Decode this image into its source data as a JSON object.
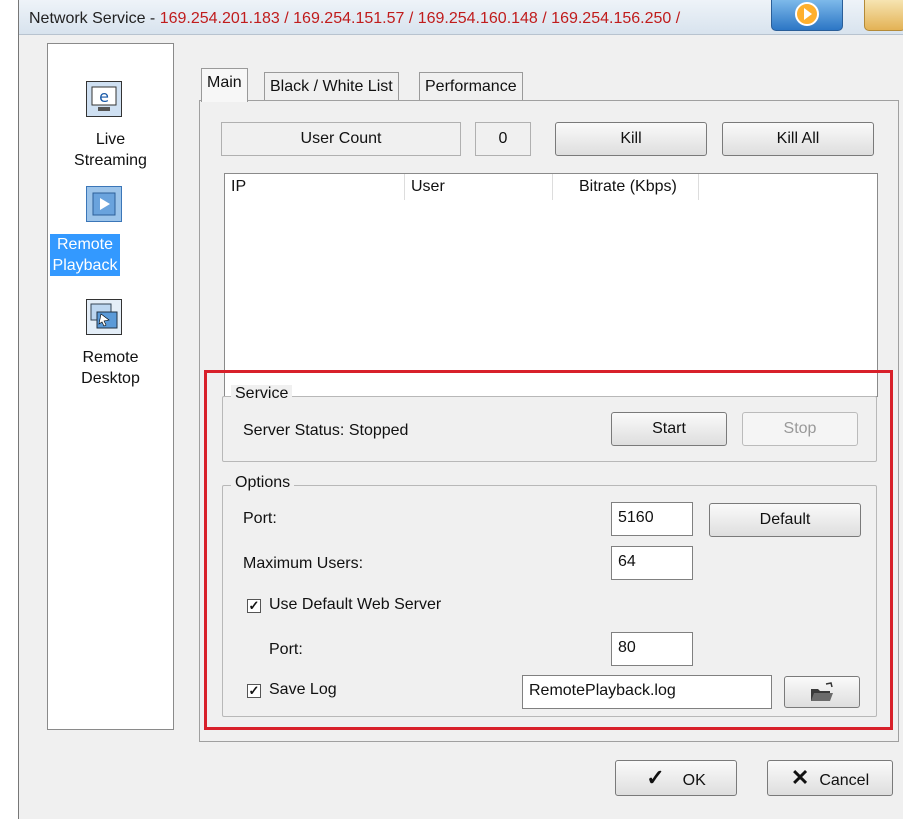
{
  "title": {
    "prefix": "Network Service - ",
    "ips": "169.254.201.183 / 169.254.151.57 / 169.254.160.148 / 169.254.156.250 /"
  },
  "sidebar": {
    "items": [
      {
        "label_line1": "Live",
        "label_line2": "Streaming",
        "icon": "live-streaming-icon",
        "selected": false
      },
      {
        "label_line1": "Remote",
        "label_line2": "Playback",
        "icon": "remote-playback-icon",
        "selected": true
      },
      {
        "label_line1": "Remote",
        "label_line2": "Desktop",
        "icon": "remote-desktop-icon",
        "selected": false
      }
    ]
  },
  "tabs": [
    "Main",
    "Black / White List",
    "Performance"
  ],
  "main": {
    "user_count_label": "User Count",
    "user_count_value": "0",
    "kill_label": "Kill",
    "kill_all_label": "Kill All",
    "columns": [
      "IP",
      "User",
      "Bitrate (Kbps)"
    ]
  },
  "service": {
    "legend": "Service",
    "status_text": "Server Status: Stopped",
    "start_label": "Start",
    "stop_label": "Stop"
  },
  "options": {
    "legend": "Options",
    "port_label": "Port:",
    "port_value": "5160",
    "default_label": "Default",
    "max_users_label": "Maximum Users:",
    "max_users_value": "64",
    "use_default_web_server_label": "Use Default Web Server",
    "use_default_web_server_checked": true,
    "web_port_label": "Port:",
    "web_port_value": "80",
    "save_log_label": "Save Log",
    "save_log_checked": true,
    "log_file_value": "RemotePlayback.log"
  },
  "footer": {
    "ok_label": "OK",
    "cancel_label": "Cancel"
  },
  "colors": {
    "highlight_box": "#d8202a",
    "selection": "#3399ff"
  }
}
